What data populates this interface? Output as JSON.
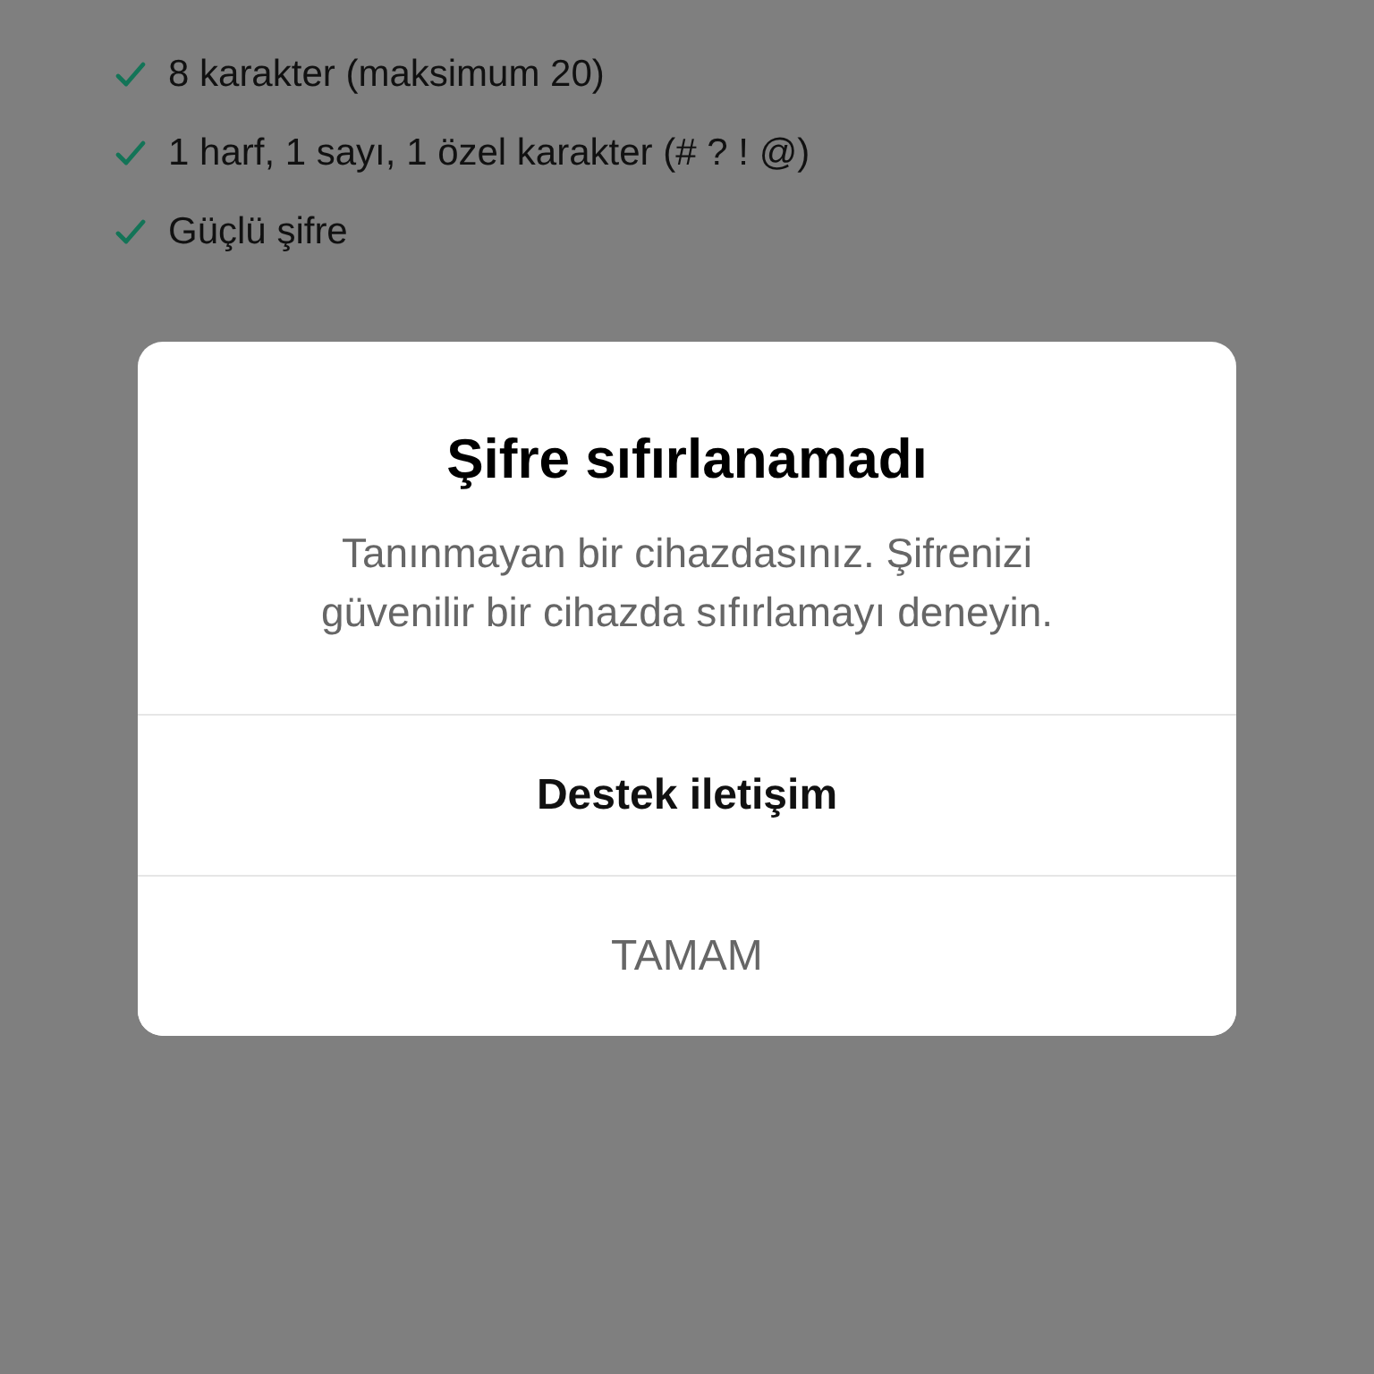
{
  "requirements": [
    {
      "label": "8 karakter (maksimum 20)",
      "met": true
    },
    {
      "label": "1 harf, 1 sayı, 1 özel karakter (# ? ! @)",
      "met": true
    },
    {
      "label": "Güçlü şifre",
      "met": true
    }
  ],
  "dialog": {
    "title": "Şifre sıfırlanamadı",
    "message": "Tanınmayan bir cihazdasınız. Şifrenizi güvenilir bir cihazda sıfırlamayı deneyin.",
    "buttons": [
      {
        "label": "Destek iletişim",
        "kind": "primary"
      },
      {
        "label": "TAMAM",
        "kind": "secondary"
      }
    ]
  }
}
